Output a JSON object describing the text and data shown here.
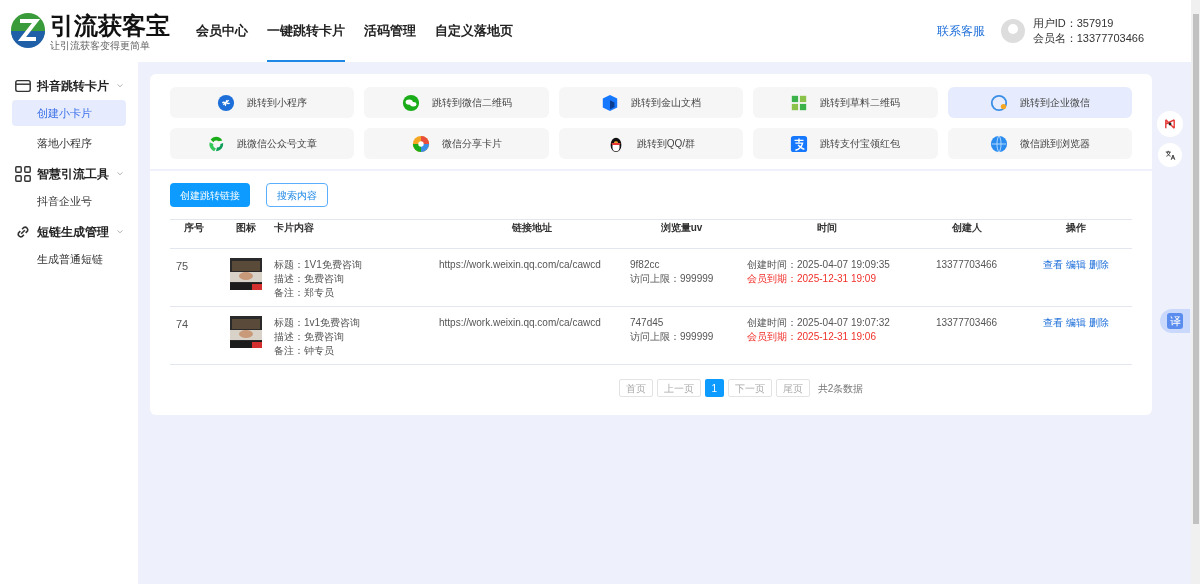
{
  "header": {
    "logo_title": "引流获客宝",
    "logo_tagline": "让引流获客变得更简单",
    "nav": [
      {
        "label": "会员中心",
        "selected": false
      },
      {
        "label": "一键跳转卡片",
        "selected": true
      },
      {
        "label": "活码管理",
        "selected": false
      },
      {
        "label": "自定义落地页",
        "selected": false
      }
    ],
    "contact": "联系客服",
    "user_id": "用户ID：357919",
    "member_name": "会员名：13377703466"
  },
  "sidebar": [
    {
      "label": "抖音跳转卡片",
      "children": [
        {
          "label": "创建小卡片",
          "selected": true
        },
        {
          "label": "落地小程序",
          "selected": false
        }
      ]
    },
    {
      "label": "智慧引流工具",
      "children": [
        {
          "label": "抖音企业号",
          "selected": false
        }
      ]
    },
    {
      "label": "短链生成管理",
      "children": [
        {
          "label": "生成普通短链",
          "selected": false
        }
      ]
    }
  ],
  "jump_types": [
    {
      "label": "跳转到小程序",
      "selected": false
    },
    {
      "label": "跳转到微信二维码",
      "selected": false
    },
    {
      "label": "跳转到金山文档",
      "selected": false
    },
    {
      "label": "跳转到草料二维码",
      "selected": false
    },
    {
      "label": "跳转到企业微信",
      "selected": true
    },
    {
      "label": "跳微信公众号文章",
      "selected": false
    },
    {
      "label": "微信分享卡片",
      "selected": false
    },
    {
      "label": "跳转到QQ/群",
      "selected": false
    },
    {
      "label": "跳转支付宝领红包",
      "selected": false
    },
    {
      "label": "微信跳到浏览器",
      "selected": false
    }
  ],
  "actions": [
    "创建跳转链接",
    "搜索内容"
  ],
  "table": {
    "columns": [
      "序号",
      "图标",
      "卡片内容",
      "链接地址",
      "浏览量uv",
      "时间",
      "创建人",
      "操作"
    ],
    "rows": [
      {
        "id": "75",
        "title": "标题：1V1免费咨询",
        "desc": "描述：免费咨询",
        "note": "备注：郑专员",
        "link": "https://work.weixin.qq.com/ca/cawcd",
        "visits": "9f82cc",
        "limit": "访问上限：999999",
        "created": "创建时间：2025-04-07 19:09:35",
        "expires": "会员到期：2025-12-31 19:09",
        "creator": "13377703466",
        "ops": [
          "查看",
          "编辑",
          "删除"
        ]
      },
      {
        "id": "74",
        "title": "标题：1v1免费咨询",
        "desc": "描述：免费咨询",
        "note": "备注：钟专员",
        "link": "https://work.weixin.qq.com/ca/cawcd",
        "visits": "747d45",
        "limit": "访问上限：999999",
        "created": "创建时间：2025-04-07 19:07:32",
        "expires": "会员到期：2025-12-31 19:06",
        "creator": "13377703466",
        "ops": [
          "查看",
          "编辑",
          "删除"
        ]
      }
    ]
  },
  "pagination": {
    "pages": [
      {
        "label": "首页",
        "kind": "nav"
      },
      {
        "label": "上一页",
        "kind": "nav"
      },
      {
        "label": "1",
        "kind": "page",
        "selected": true
      },
      {
        "label": "下一页",
        "kind": "nav"
      },
      {
        "label": "尾页",
        "kind": "nav"
      }
    ],
    "total": "共2条数据"
  },
  "float_translate": "译"
}
